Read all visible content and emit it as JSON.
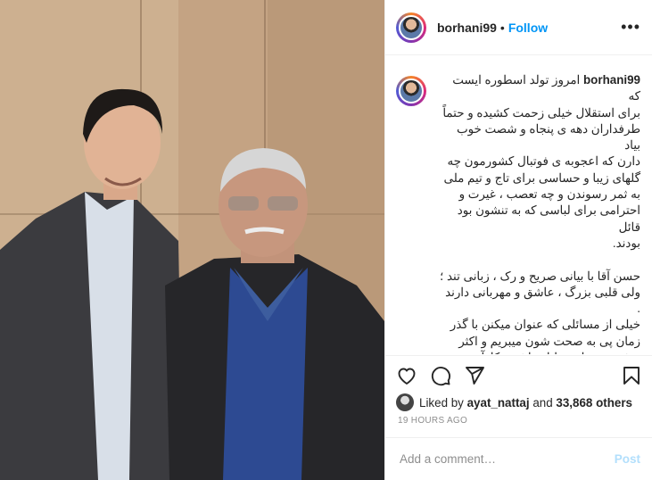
{
  "header": {
    "username": "borhani99",
    "separator": "•",
    "follow_label": "Follow",
    "more_icon": "more-options-icon"
  },
  "caption": {
    "username": "borhani99",
    "text": "امروز تولد اسطوره ایست که\nبرای استقلال خیلی زحمت کشیده و حتماً\nطرفداران دهه ی پنجاه و شصت خوب بیاد\nدارن که اعجوبه ی فوتبال کشورمون چه\nگلهای زیبا و حساسی برای تاج و تیم ملی\nبه ثمر رسوندن و چه تعصب ، غیرت و\nاحترامی برای لباسی که به تنشون بود قائل\nبودند.\n\nحسن آقا با بیانی صریح و رک ، زبانی تند ؛\nولی قلبی بزرگ ، عاشق و مهربانی دارند .\nخیلی از مسائلی که عنوان میکنن با گذر\nزمان پی به صحت شون میبریم و اکثر\nپیش بینی ها و تحلیل هاشون کارآمد و\nدرسته .\nشاید در مواردی من هم موافق بیان بعضی\nاز صحبتهاشون نباشم ولی این موضوع\nباعث نمیشه که ارادت ، احترام و علاقه ام\nنسبت به حسن آقا کم بشه ."
  },
  "actions": {
    "like_icon": "heart-icon",
    "comment_icon": "comment-icon",
    "share_icon": "share-icon",
    "save_icon": "bookmark-icon"
  },
  "likes": {
    "prefix": "Liked by",
    "user": "ayat_nattaj",
    "middle": "and",
    "count": "33,868 others"
  },
  "timestamp": "19 HOURS AGO",
  "comment_box": {
    "placeholder": "Add a comment…",
    "post_label": "Post"
  },
  "colors": {
    "accent": "#0095f6",
    "post_disabled": "#b2dffc",
    "muted": "#8e8e8e"
  }
}
